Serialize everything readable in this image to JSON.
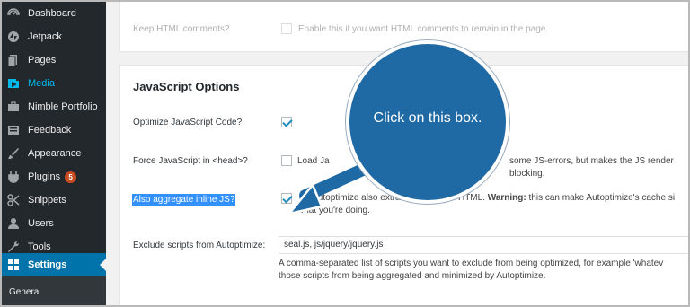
{
  "sidebar": {
    "items": [
      {
        "label": "Dashboard",
        "icon": "dashboard-icon"
      },
      {
        "label": "Jetpack",
        "icon": "jetpack-icon"
      },
      {
        "label": "Pages",
        "icon": "pages-icon"
      },
      {
        "label": "Media",
        "icon": "media-icon"
      },
      {
        "label": "Nimble Portfolio",
        "icon": "portfolio-icon"
      },
      {
        "label": "Feedback",
        "icon": "feedback-icon"
      },
      {
        "label": "Appearance",
        "icon": "appearance-icon"
      },
      {
        "label": "Plugins",
        "icon": "plugins-icon",
        "badge": "5"
      },
      {
        "label": "Snippets",
        "icon": "snippets-icon"
      },
      {
        "label": "Users",
        "icon": "users-icon"
      },
      {
        "label": "Tools",
        "icon": "tools-icon"
      },
      {
        "label": "Settings",
        "icon": "settings-icon"
      }
    ],
    "submenu": {
      "general": "General"
    }
  },
  "html_section": {
    "keep_comments_label": "Keep HTML comments?",
    "keep_comments_desc": "Enable this if you want HTML comments to remain in the page."
  },
  "js_section": {
    "title": "JavaScript Options",
    "optimize_label": "Optimize JavaScript Code?",
    "force_head_label": "Force JavaScript in <head>?",
    "force_head_desc_start": "Load Ja",
    "force_head_desc_end": "some JS-errors, but makes the JS render blocking.",
    "aggregate_label": "Also aggregate inline JS?",
    "aggregate_desc_line1_start": "Let Autoptimize also extract JS from the HTML.",
    "aggregate_desc_warning": "Warning:",
    "aggregate_desc_line1_end": "this can make Autoptimize's cache si",
    "aggregate_desc_line2": "what you're doing.",
    "exclude_label": "Exclude scripts from Autoptimize:",
    "exclude_value": "seal.js, js/jquery/jquery.js",
    "exclude_desc_line1": "A comma-separated list of scripts you want to exclude from being optimized, for example 'whatev",
    "exclude_desc_line2": "those scripts from being aggregated and minimized by Autoptimize."
  },
  "callout": {
    "text": "Click on this box."
  },
  "colors": {
    "sidebar_bg": "#23282d",
    "accent": "#0073aa",
    "callout": "#1f6aa5",
    "badge": "#ca4a1f"
  }
}
